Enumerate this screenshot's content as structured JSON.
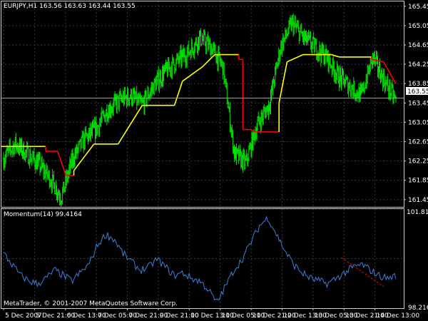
{
  "header": {
    "symbol_info": "EURJPY,H1  163.56 163.63 163.44 163.55"
  },
  "indicator": {
    "label": "Momentum(14) 99.4164"
  },
  "watermark": "MetaTrader, © 2001-2007 MetaQuotes Software Corp.",
  "price_axis": {
    "ticks": [
      "165.45",
      "165.05",
      "164.65",
      "164.25",
      "163.85",
      "163.45",
      "163.05",
      "162.65",
      "162.25",
      "161.85",
      "161.45"
    ],
    "current_price_label": "163.55"
  },
  "momentum_axis": {
    "ticks": [
      "101.8125",
      "98.216"
    ]
  },
  "time_axis": {
    "labels": [
      "5 Dec 2007",
      "5 Dec 21:00",
      "6 Dec 13:00",
      "7 Dec 05:00",
      "7 Dec 21:00",
      "9 Dec 21:00",
      "10 Dec 13:00",
      "11 Dec 05:00",
      "11 Dec 21:00",
      "12 Dec 13:00",
      "13 Dec 05:00",
      "13 Dec 21:00",
      "14 Dec 13:00"
    ]
  },
  "colors": {
    "background": "#000000",
    "grid": "#3a3a3a",
    "bars": "#00e000",
    "stop_up": "#ffff00",
    "stop_down": "#ff0000",
    "momentum": "#3c7fd8",
    "trendline": "#ff0000",
    "axis_text": "#ffffff"
  },
  "chart_data": [
    {
      "type": "ohlc",
      "symbol": "EURJPY",
      "timeframe": "H1",
      "last": {
        "open": 163.56,
        "high": 163.63,
        "low": 163.44,
        "close": 163.55
      },
      "ylim": [
        161.3,
        165.55
      ],
      "x_labels": [
        "5 Dec 2007",
        "5 Dec 21:00",
        "6 Dec 13:00",
        "7 Dec 05:00",
        "7 Dec 21:00",
        "9 Dec 21:00",
        "10 Dec 13:00",
        "11 Dec 05:00",
        "11 Dec 21:00",
        "12 Dec 13:00",
        "13 Dec 05:00",
        "13 Dec 21:00",
        "14 Dec 13:00"
      ],
      "close_anchors": [
        162.3,
        162.6,
        162.4,
        162.2,
        161.9,
        161.5,
        162.3,
        162.7,
        162.9,
        163.3,
        163.5,
        163.6,
        163.4,
        163.8,
        164.1,
        164.3,
        164.5,
        164.8,
        164.6,
        164.2,
        162.4,
        162.2,
        163.0,
        163.4,
        164.6,
        165.1,
        164.8,
        164.6,
        164.4,
        164.0,
        163.8,
        163.6,
        164.4,
        163.9,
        163.5
      ],
      "trailing_stop": [
        {
          "x": 0,
          "y": 162.55,
          "trend": "up"
        },
        {
          "x": 0.11,
          "y": 162.55,
          "trend": "up"
        },
        {
          "x": 0.11,
          "y": 162.45,
          "trend": "down"
        },
        {
          "x": 0.14,
          "y": 162.45,
          "trend": "down"
        },
        {
          "x": 0.16,
          "y": 161.95,
          "trend": "down"
        },
        {
          "x": 0.18,
          "y": 161.95,
          "trend": "down"
        },
        {
          "x": 0.18,
          "y": 162.05,
          "trend": "up"
        },
        {
          "x": 0.23,
          "y": 162.6,
          "trend": "up"
        },
        {
          "x": 0.29,
          "y": 162.6,
          "trend": "up"
        },
        {
          "x": 0.32,
          "y": 163.0,
          "trend": "up"
        },
        {
          "x": 0.35,
          "y": 163.4,
          "trend": "up"
        },
        {
          "x": 0.43,
          "y": 163.4,
          "trend": "up"
        },
        {
          "x": 0.45,
          "y": 163.9,
          "trend": "up"
        },
        {
          "x": 0.5,
          "y": 164.2,
          "trend": "up"
        },
        {
          "x": 0.53,
          "y": 164.45,
          "trend": "up"
        },
        {
          "x": 0.59,
          "y": 164.45,
          "trend": "up"
        },
        {
          "x": 0.59,
          "y": 164.35,
          "trend": "down"
        },
        {
          "x": 0.6,
          "y": 164.35,
          "trend": "down"
        },
        {
          "x": 0.6,
          "y": 162.9,
          "trend": "down"
        },
        {
          "x": 0.62,
          "y": 162.9,
          "trend": "down"
        },
        {
          "x": 0.63,
          "y": 162.85,
          "trend": "down"
        },
        {
          "x": 0.69,
          "y": 162.85,
          "trend": "down"
        },
        {
          "x": 0.69,
          "y": 163.45,
          "trend": "up"
        },
        {
          "x": 0.71,
          "y": 164.3,
          "trend": "up"
        },
        {
          "x": 0.75,
          "y": 164.45,
          "trend": "up"
        },
        {
          "x": 0.82,
          "y": 164.45,
          "trend": "up"
        },
        {
          "x": 0.84,
          "y": 164.4,
          "trend": "up"
        },
        {
          "x": 0.92,
          "y": 164.4,
          "trend": "up"
        },
        {
          "x": 0.92,
          "y": 164.35,
          "trend": "down"
        },
        {
          "x": 0.95,
          "y": 164.3,
          "trend": "down"
        },
        {
          "x": 0.98,
          "y": 163.85,
          "trend": "down"
        }
      ]
    },
    {
      "type": "line",
      "name": "Momentum(14)",
      "last_value": 99.4164,
      "ylim": [
        98.216,
        101.8125
      ],
      "anchors": [
        100.2,
        99.8,
        99.4,
        99.2,
        99.1,
        99.3,
        99.6,
        99.4,
        99.2,
        99.5,
        99.8,
        100.5,
        100.9,
        100.7,
        100.2,
        99.9,
        99.6,
        99.7,
        100.0,
        99.7,
        99.4,
        99.5,
        99.3,
        99.2,
        98.9,
        98.4,
        99.0,
        99.6,
        100.0,
        100.6,
        101.2,
        101.5,
        100.9,
        100.3,
        99.8,
        99.5,
        99.3,
        99.2,
        99.1,
        99.3,
        99.5,
        99.7,
        99.8,
        99.6,
        99.4,
        99.3,
        99.4
      ],
      "trendline": [
        {
          "x": 0.845,
          "y": 100.05
        },
        {
          "x": 0.95,
          "y": 99.0
        }
      ]
    }
  ]
}
